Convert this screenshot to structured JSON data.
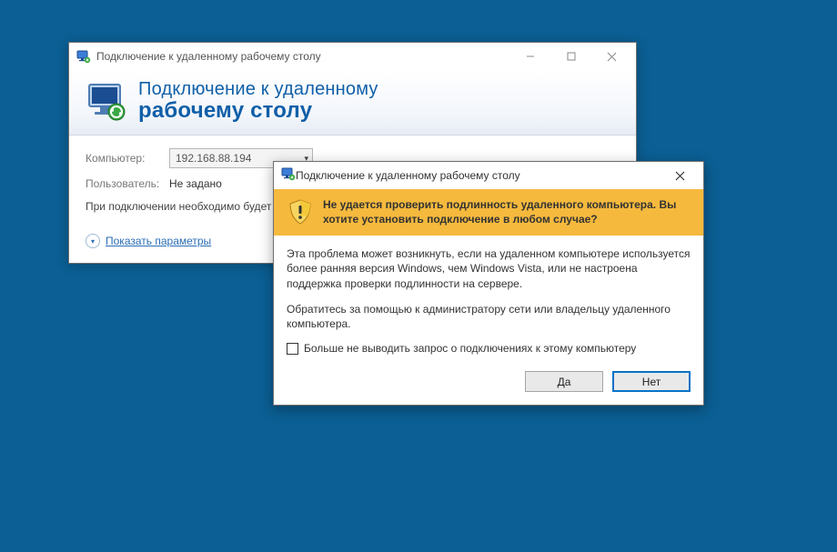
{
  "rdp": {
    "title": "Подключение к удаленному рабочему столу",
    "header_line1": "Подключение к удаленному",
    "header_line2": "рабочему столу",
    "computer_label": "Компьютер:",
    "computer_value": "192.168.88.194",
    "user_label": "Пользователь:",
    "user_value": "Не задано",
    "info_line": "При подключении необходимо будет указать учетные данные.",
    "show_options_label": "Показать параметры"
  },
  "dialog": {
    "title": "Подключение к удаленному рабочему столу",
    "warn_text": "Не удается проверить подлинность удаленного компьютера. Вы хотите установить подключение в любом случае?",
    "para1": "Эта проблема может возникнуть, если на удаленном компьютере используется более ранняя версия Windows, чем Windows Vista, или не настроена поддержка проверки подлинности на сервере.",
    "para2": "Обратитесь за помощью к администратору сети или владельцу удаленного компьютера.",
    "checkbox_label": "Больше не выводить запрос о подключениях к этому компьютеру",
    "yes_label": "Да",
    "no_label": "Нет"
  }
}
